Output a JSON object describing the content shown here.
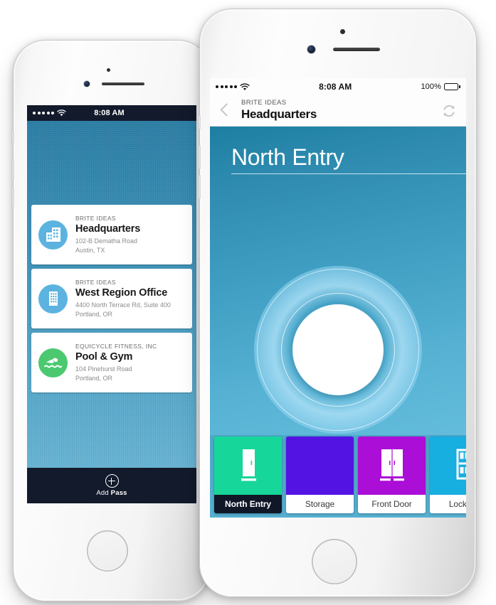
{
  "scene": {
    "description": "Two iPhones showing a mobile access-control app"
  },
  "back_phone": {
    "status_bar": {
      "signal_dots": 5,
      "wifi_icon": "wifi-icon",
      "time": "8:08 AM"
    },
    "passes": [
      {
        "org": "BRITE IDEAS",
        "name": "Headquarters",
        "address_line1": "102-B Dematha Road",
        "address_line2": "Austin, TX",
        "icon": "office-buildings-icon",
        "icon_color": "#5cb3e0"
      },
      {
        "org": "BRITE IDEAS",
        "name": "West Region Office",
        "address_line1": "4400 North Terrace Rd, Suite 400",
        "address_line2": "Portland, OR",
        "icon": "office-tower-icon",
        "icon_color": "#5cb3e0"
      },
      {
        "org": "EQUICYCLE FITNESS, INC",
        "name": "Pool & Gym",
        "address_line1": "104 Pinehurst Road",
        "address_line2": "Portland, OR",
        "icon": "swimmer-icon",
        "icon_color": "#4cc970"
      }
    ],
    "add_pass": {
      "icon": "plus-circle-icon",
      "label_prefix": "Add ",
      "label_bold": "Pass"
    }
  },
  "front_phone": {
    "status_bar": {
      "signal_dots": 5,
      "wifi_icon": "wifi-icon",
      "time": "8:08 AM",
      "battery_percent": "100%",
      "battery_icon": "battery-full-icon"
    },
    "nav": {
      "back_icon": "chevron-left-icon",
      "org": "BRITE IDEAS",
      "title": "Headquarters",
      "refresh_icon": "refresh-icon"
    },
    "door": {
      "title": "North Entry",
      "unlock_button": "unlock-button"
    },
    "tabs": [
      {
        "label": "North Entry",
        "color": "#17d69a",
        "icon": "single-door-icon",
        "selected": true
      },
      {
        "label": "Storage",
        "color": "#5313e3",
        "icon": "single-door-icon",
        "selected": false
      },
      {
        "label": "Front Door",
        "color": "#ab0ed6",
        "icon": "double-door-icon",
        "selected": false
      },
      {
        "label": "Lockers",
        "color": "#17aee0",
        "icon": "locker-door-icon",
        "selected": false
      }
    ]
  },
  "colors": {
    "accent_blue": "#3f9ec2",
    "dark_bar": "#121a2b",
    "list_bg_top": "#2d7fa6",
    "list_bg_bottom": "#68b4d4"
  }
}
